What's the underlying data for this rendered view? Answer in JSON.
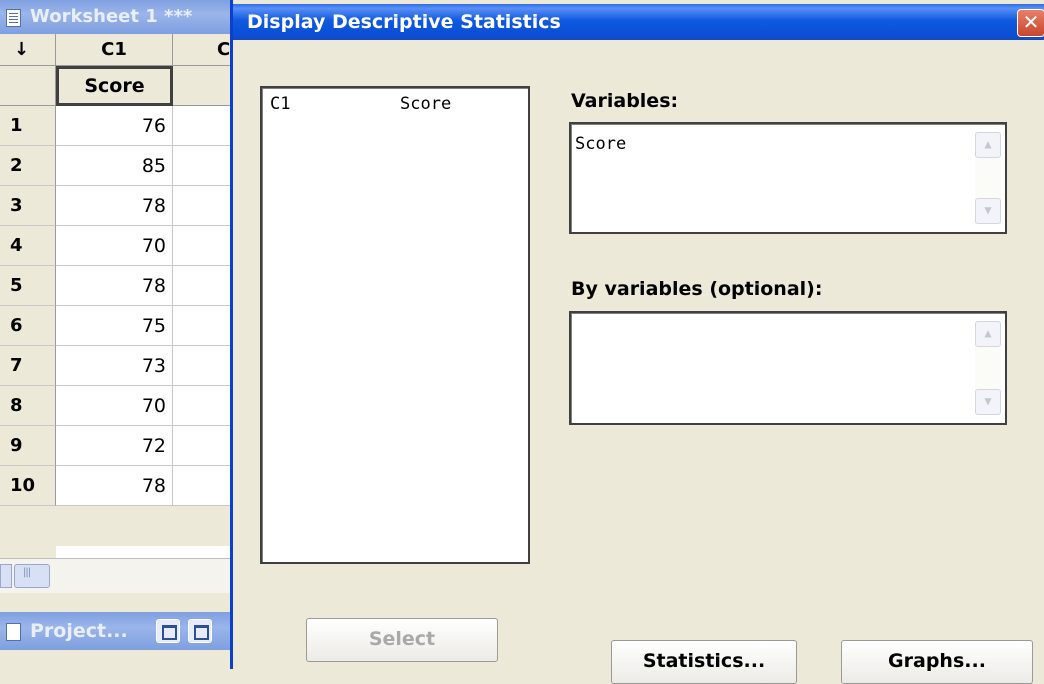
{
  "worksheet": {
    "title": "Worksheet 1 ***",
    "corner_label": "↓",
    "column_id": "C1",
    "column_next_partial": "C",
    "column_name": "Score",
    "rows": [
      {
        "n": "1",
        "value": "76"
      },
      {
        "n": "2",
        "value": "85"
      },
      {
        "n": "3",
        "value": "78"
      },
      {
        "n": "4",
        "value": "70"
      },
      {
        "n": "5",
        "value": "78"
      },
      {
        "n": "6",
        "value": "75"
      },
      {
        "n": "7",
        "value": "73"
      },
      {
        "n": "8",
        "value": "70"
      },
      {
        "n": "9",
        "value": "72"
      },
      {
        "n": "10",
        "value": "78"
      }
    ]
  },
  "project": {
    "title": "Project..."
  },
  "dialog": {
    "title": "Display Descriptive Statistics",
    "close_glyph": "✕",
    "variable_list": [
      {
        "id": "C1",
        "name": "Score"
      }
    ],
    "variables_label": "Variables:",
    "variables_value": "Score",
    "by_variables_label": "By variables (optional):",
    "by_variables_value": "",
    "buttons": {
      "select": "Select",
      "statistics": "Statistics...",
      "graphs": "Graphs..."
    }
  }
}
